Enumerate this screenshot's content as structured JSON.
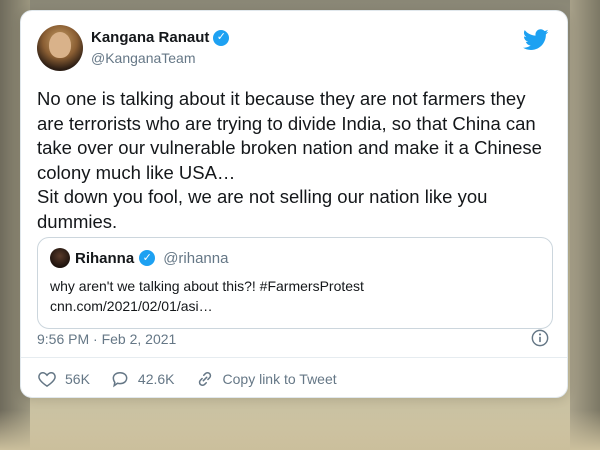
{
  "author": {
    "display_name": "Kangana Ranaut",
    "handle": "@KanganaTeam"
  },
  "tweet": {
    "text": "No one is talking about it because they are not farmers they are terrorists who are trying to divide India, so that China can take over our vulnerable broken nation and make it a Chinese colony much like USA…\nSit down you fool, we are not selling our nation like you dummies.",
    "timestamp": "9:56 PM · Feb 2, 2021"
  },
  "quoted": {
    "display_name": "Rihanna",
    "handle": "@rihanna",
    "text_line1": "why aren't we talking about this?! #FarmersProtest",
    "text_line2": "cnn.com/2021/02/01/asi…"
  },
  "actions": {
    "likes": "56K",
    "replies": "42.6K",
    "copy_link_label": "Copy link to Tweet"
  },
  "colors": {
    "accent": "#1da1f2",
    "text": "#14171a",
    "secondary": "#657786"
  }
}
